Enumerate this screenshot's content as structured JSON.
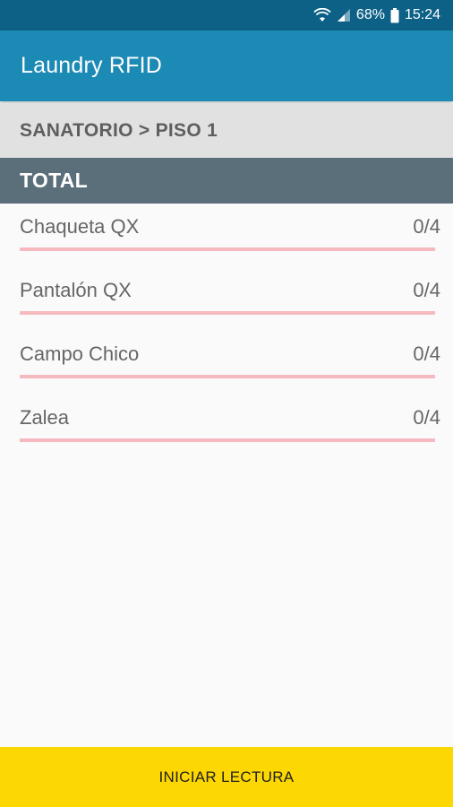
{
  "status_bar": {
    "battery_percent": "68%",
    "time": "15:24",
    "icons": [
      "wifi-icon",
      "signal-icon",
      "battery-icon"
    ]
  },
  "app_bar": {
    "title": "Laundry RFID"
  },
  "breadcrumb": "SANATORIO > PISO 1",
  "section": {
    "title": "TOTAL"
  },
  "items": [
    {
      "name": "Chaqueta QX",
      "count_text": "0/4",
      "progress": 0
    },
    {
      "name": "Pantalón QX",
      "count_text": "0/4",
      "progress": 0
    },
    {
      "name": "Campo Chico",
      "count_text": "0/4",
      "progress": 0
    },
    {
      "name": "Zalea",
      "count_text": "0/4",
      "progress": 0
    }
  ],
  "start_button": {
    "label": "INICIAR LECTURA"
  },
  "colors": {
    "status_bar": "#0d6187",
    "app_bar": "#1b8ab5",
    "breadcrumb_bg": "#e1e1e1",
    "section_header": "#5b6f7a",
    "progress_track": "#f5b9bf",
    "button_bg": "#fcd702"
  }
}
